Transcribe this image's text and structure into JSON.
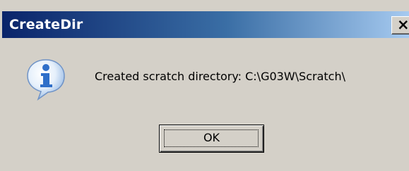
{
  "window": {
    "title": "CreateDir"
  },
  "titlebar": {
    "close_glyph": "×",
    "close_icon": "close-icon"
  },
  "message": {
    "icon": "info-icon",
    "text": "Created scratch directory: C:\\G03W\\Scratch\\"
  },
  "buttons": {
    "ok_label": "OK"
  },
  "colors": {
    "dialog_bg": "#d4d0c8",
    "title_start": "#0a246a",
    "title_end": "#a6caf0",
    "title_text": "#ffffff",
    "icon_blue": "#2f6fc9"
  }
}
